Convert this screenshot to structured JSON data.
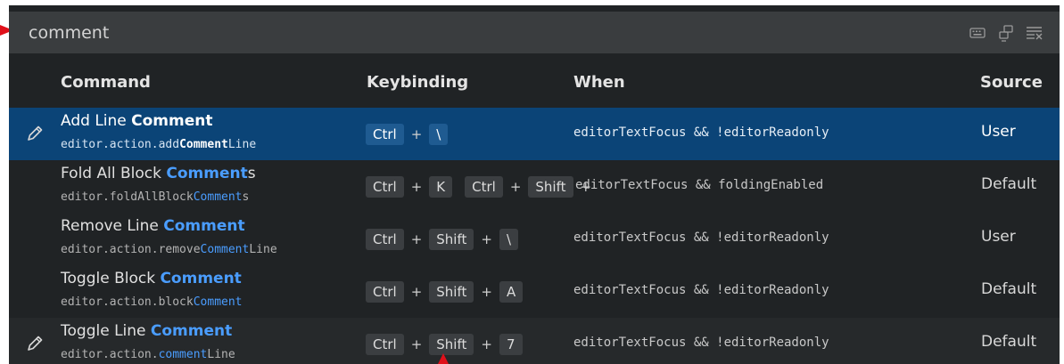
{
  "search": {
    "value": "comment",
    "tools": [
      "keyboard-icon",
      "sort-by-precedence-icon",
      "clear-filter-icon"
    ]
  },
  "headers": {
    "command": "Command",
    "keybinding": "Keybinding",
    "when": "When",
    "source": "Source"
  },
  "rows": [
    {
      "title_pre": "Add Line ",
      "title_hl": "Comment",
      "title_post": "",
      "id_pre": "editor.action.add",
      "id_hl": "Comment",
      "id_post": "Line",
      "keys": [
        "Ctrl",
        "+",
        "\\"
      ],
      "keys2": [],
      "when": "editorTextFocus && !editorReadonly",
      "source": "User",
      "edit_icon": true,
      "selected": true
    },
    {
      "title_pre": "Fold All Block ",
      "title_hl": "Comment",
      "title_post": "s",
      "id_pre": "editor.foldAllBlock",
      "id_hl": "Comment",
      "id_post": "s",
      "keys": [
        "Ctrl",
        "+",
        "K"
      ],
      "keys2": [
        "Ctrl",
        "+",
        "Shift",
        "+"
      ],
      "when": "editorTextFocus && foldingEnabled",
      "source": "Default",
      "edit_icon": false,
      "selected": false
    },
    {
      "title_pre": "Remove Line ",
      "title_hl": "Comment",
      "title_post": "",
      "id_pre": "editor.action.remove",
      "id_hl": "Comment",
      "id_post": "Line",
      "keys": [
        "Ctrl",
        "+",
        "Shift",
        "+",
        "\\"
      ],
      "keys2": [],
      "when": "editorTextFocus && !editorReadonly",
      "source": "User",
      "edit_icon": false,
      "selected": false
    },
    {
      "title_pre": "Toggle Block ",
      "title_hl": "Comment",
      "title_post": "",
      "id_pre": "editor.action.block",
      "id_hl": "Comment",
      "id_post": "",
      "keys": [
        "Ctrl",
        "+",
        "Shift",
        "+",
        "A"
      ],
      "keys2": [],
      "when": "editorTextFocus && !editorReadonly",
      "source": "Default",
      "edit_icon": false,
      "selected": false
    },
    {
      "title_pre": "Toggle Line ",
      "title_hl": "Comment",
      "title_post": "",
      "id_pre": "editor.action.",
      "id_hl": "comment",
      "id_post": "Line",
      "keys": [
        "Ctrl",
        "+",
        "Shift",
        "+",
        "7"
      ],
      "keys2": [],
      "when": "editorTextFocus && !editorReadonly",
      "source": "Default",
      "edit_icon": true,
      "selected": false
    }
  ],
  "colors": {
    "background": "#202325",
    "selection": "#0b4477",
    "highlight": "#4a9dff",
    "annotation_arrow": "#e0101a"
  }
}
